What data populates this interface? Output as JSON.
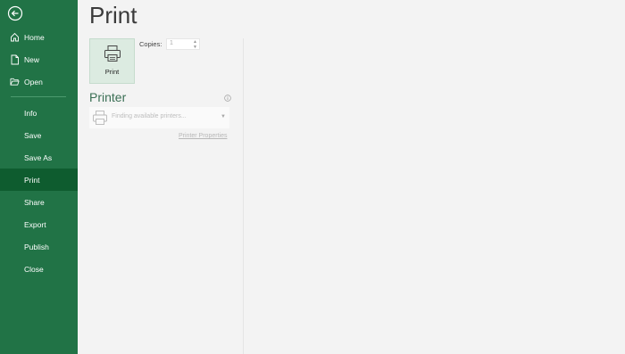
{
  "sidebar": {
    "nav": [
      {
        "id": "home",
        "label": "Home",
        "icon": "home-icon"
      },
      {
        "id": "new",
        "label": "New",
        "icon": "new-document-icon"
      },
      {
        "id": "open",
        "label": "Open",
        "icon": "folder-open-icon"
      },
      {
        "id": "info",
        "label": "Info"
      },
      {
        "id": "save",
        "label": "Save"
      },
      {
        "id": "save-as",
        "label": "Save As"
      },
      {
        "id": "print",
        "label": "Print",
        "active": true
      },
      {
        "id": "share",
        "label": "Share"
      },
      {
        "id": "export",
        "label": "Export"
      },
      {
        "id": "publish",
        "label": "Publish"
      },
      {
        "id": "close",
        "label": "Close"
      }
    ]
  },
  "main": {
    "title": "Print",
    "print_button_label": "Print",
    "copies_label": "Copies:",
    "copies_value": "1",
    "printer_heading": "Printer",
    "printer_select_text": "Finding available printers...",
    "printer_properties_link": "Printer Properties"
  },
  "colors": {
    "sidebar_bg": "#217346",
    "sidebar_active": "#0e5c2f",
    "accent_text": "#3a6f54"
  }
}
